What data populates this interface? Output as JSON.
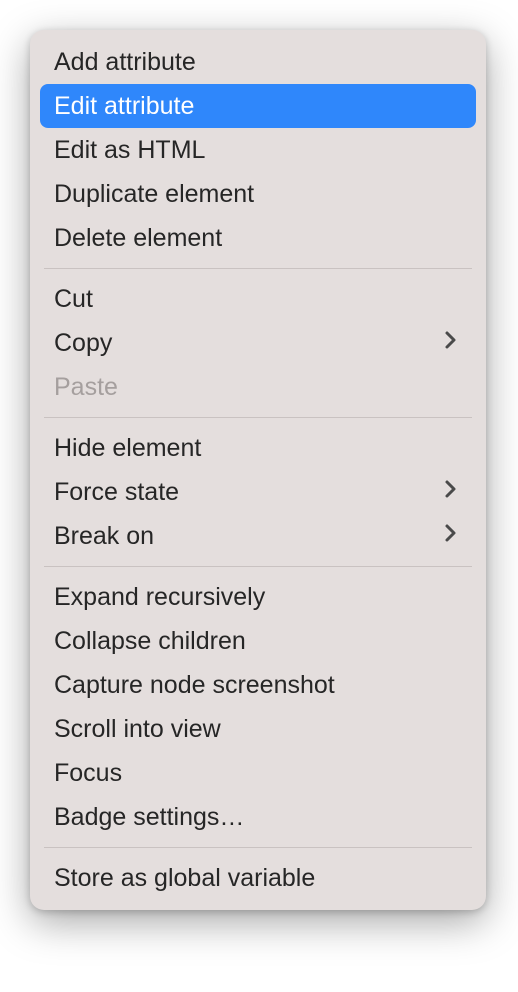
{
  "menu": {
    "sections": [
      {
        "items": [
          {
            "id": "add-attribute",
            "label": "Add attribute",
            "submenu": false,
            "disabled": false,
            "highlighted": false
          },
          {
            "id": "edit-attribute",
            "label": "Edit attribute",
            "submenu": false,
            "disabled": false,
            "highlighted": true
          },
          {
            "id": "edit-as-html",
            "label": "Edit as HTML",
            "submenu": false,
            "disabled": false,
            "highlighted": false
          },
          {
            "id": "duplicate-element",
            "label": "Duplicate element",
            "submenu": false,
            "disabled": false,
            "highlighted": false
          },
          {
            "id": "delete-element",
            "label": "Delete element",
            "submenu": false,
            "disabled": false,
            "highlighted": false
          }
        ]
      },
      {
        "items": [
          {
            "id": "cut",
            "label": "Cut",
            "submenu": false,
            "disabled": false,
            "highlighted": false
          },
          {
            "id": "copy",
            "label": "Copy",
            "submenu": true,
            "disabled": false,
            "highlighted": false
          },
          {
            "id": "paste",
            "label": "Paste",
            "submenu": false,
            "disabled": true,
            "highlighted": false
          }
        ]
      },
      {
        "items": [
          {
            "id": "hide-element",
            "label": "Hide element",
            "submenu": false,
            "disabled": false,
            "highlighted": false
          },
          {
            "id": "force-state",
            "label": "Force state",
            "submenu": true,
            "disabled": false,
            "highlighted": false
          },
          {
            "id": "break-on",
            "label": "Break on",
            "submenu": true,
            "disabled": false,
            "highlighted": false
          }
        ]
      },
      {
        "items": [
          {
            "id": "expand-recursively",
            "label": "Expand recursively",
            "submenu": false,
            "disabled": false,
            "highlighted": false
          },
          {
            "id": "collapse-children",
            "label": "Collapse children",
            "submenu": false,
            "disabled": false,
            "highlighted": false
          },
          {
            "id": "capture-node-screenshot",
            "label": "Capture node screenshot",
            "submenu": false,
            "disabled": false,
            "highlighted": false
          },
          {
            "id": "scroll-into-view",
            "label": "Scroll into view",
            "submenu": false,
            "disabled": false,
            "highlighted": false
          },
          {
            "id": "focus",
            "label": "Focus",
            "submenu": false,
            "disabled": false,
            "highlighted": false
          },
          {
            "id": "badge-settings",
            "label": "Badge settings…",
            "submenu": false,
            "disabled": false,
            "highlighted": false
          }
        ]
      },
      {
        "items": [
          {
            "id": "store-as-global-variable",
            "label": "Store as global variable",
            "submenu": false,
            "disabled": false,
            "highlighted": false
          }
        ]
      }
    ]
  },
  "colors": {
    "menu_bg": "#e4dedd",
    "highlight_bg": "#2f87fb",
    "text": "#262626",
    "disabled_text": "#a59f9e",
    "divider": "#c9c2c1"
  }
}
